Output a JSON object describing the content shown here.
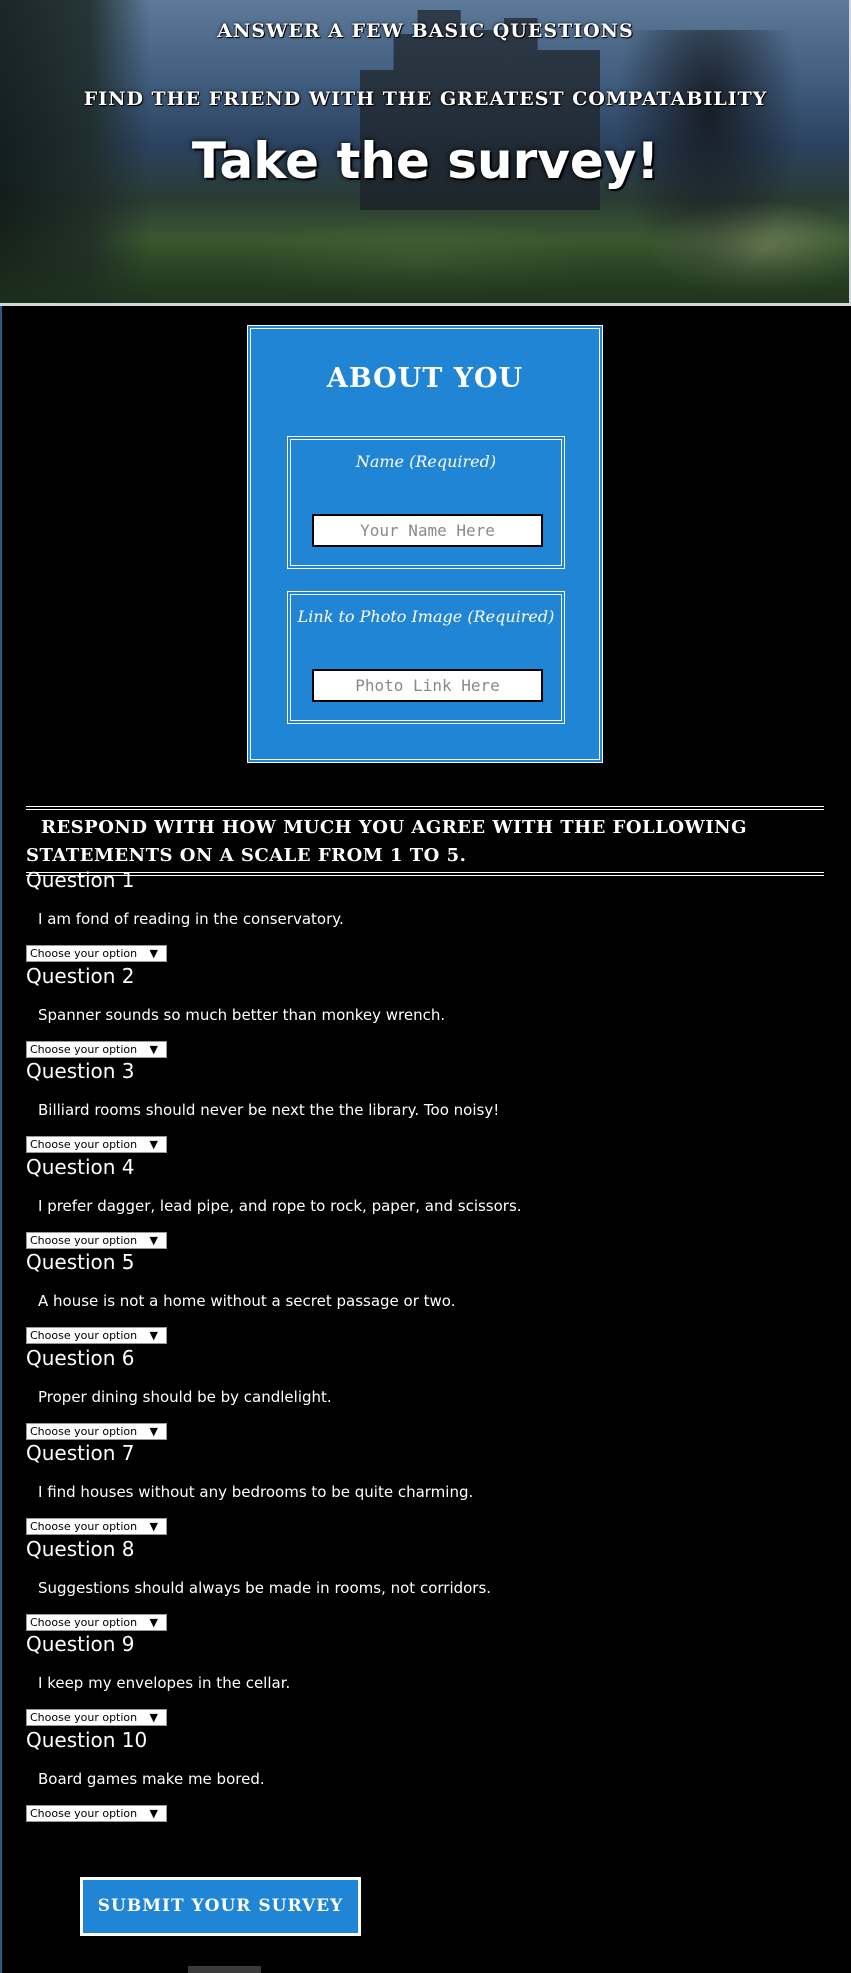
{
  "header": {
    "line1": "ANSWER A FEW BASIC QUESTIONS",
    "line2": "FIND THE FRIEND WITH THE GREATEST COMPATABILITY",
    "title": "Take the survey!"
  },
  "about": {
    "title": "ABOUT YOU",
    "name_label": "Name (Required)",
    "name_placeholder": "Your Name Here",
    "photo_label": "Link to Photo Image (Required)",
    "photo_placeholder": "Photo Link Here"
  },
  "instructions": "RESPOND WITH HOW MUCH YOU AGREE WITH THE FOLLOWING STATEMENTS ON A SCALE FROM 1 TO 5.",
  "questions": [
    {
      "title": "Question 1",
      "text": "I am fond of reading in the conservatory.",
      "selected": "Choose your option"
    },
    {
      "title": "Question 2",
      "text": "Spanner sounds so much better than monkey wrench.",
      "selected": "Choose your option"
    },
    {
      "title": "Question 3",
      "text": "Billiard rooms should never be next the the library. Too noisy!",
      "selected": "Choose your option"
    },
    {
      "title": "Question 4",
      "text": "I prefer dagger, lead pipe, and rope to rock, paper, and scissors.",
      "selected": "Choose your option"
    },
    {
      "title": "Question 5",
      "text": "A house is not a home without a secret passage or two.",
      "selected": "Choose your option"
    },
    {
      "title": "Question 6",
      "text": "Proper dining should be by candlelight.",
      "selected": "Choose your option"
    },
    {
      "title": "Question 7",
      "text": "I find houses without any bedrooms to be quite charming.",
      "selected": "Choose your option"
    },
    {
      "title": "Question 8",
      "text": "Suggestions should always be made in rooms, not corridors.",
      "selected": "Choose your option"
    },
    {
      "title": "Question 9",
      "text": "I keep my envelopes in the cellar.",
      "selected": "Choose your option"
    },
    {
      "title": "Question 10",
      "text": "Board games make me bored.",
      "selected": "Choose your option"
    }
  ],
  "submit_label": "SUBMIT YOUR SURVEY",
  "colors": {
    "accent": "#2185d5",
    "background": "#000000",
    "text": "#ffffff"
  },
  "icons": {
    "dropdown": "triangle-down-icon"
  }
}
